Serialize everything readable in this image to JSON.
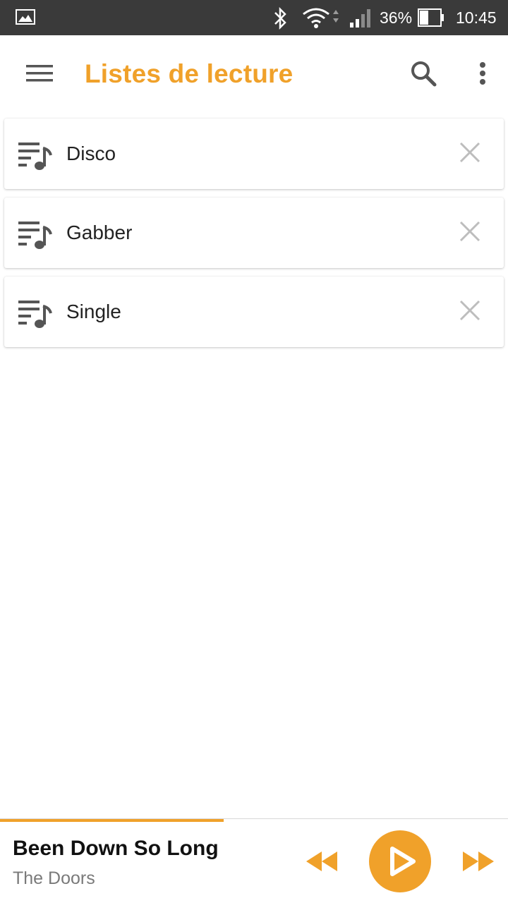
{
  "status_bar": {
    "battery_percent": "36%",
    "time": "10:45",
    "icons": [
      "gallery-icon",
      "bluetooth-icon",
      "wifi-icon",
      "signal-icon",
      "battery-icon"
    ]
  },
  "app_bar": {
    "title": "Listes de lecture",
    "icons": [
      "menu-icon",
      "search-icon",
      "more-vert-icon"
    ]
  },
  "playlists": [
    {
      "name": "Disco"
    },
    {
      "name": "Gabber"
    },
    {
      "name": "Single"
    }
  ],
  "now_playing": {
    "title": "Been Down So Long",
    "artist": "The Doors",
    "progress": 0.44
  },
  "colors": {
    "accent": "#f0a12a",
    "status_bar": "#3a3a3a",
    "icon_gray": "#555555",
    "close_gray": "#bdbdbd"
  }
}
